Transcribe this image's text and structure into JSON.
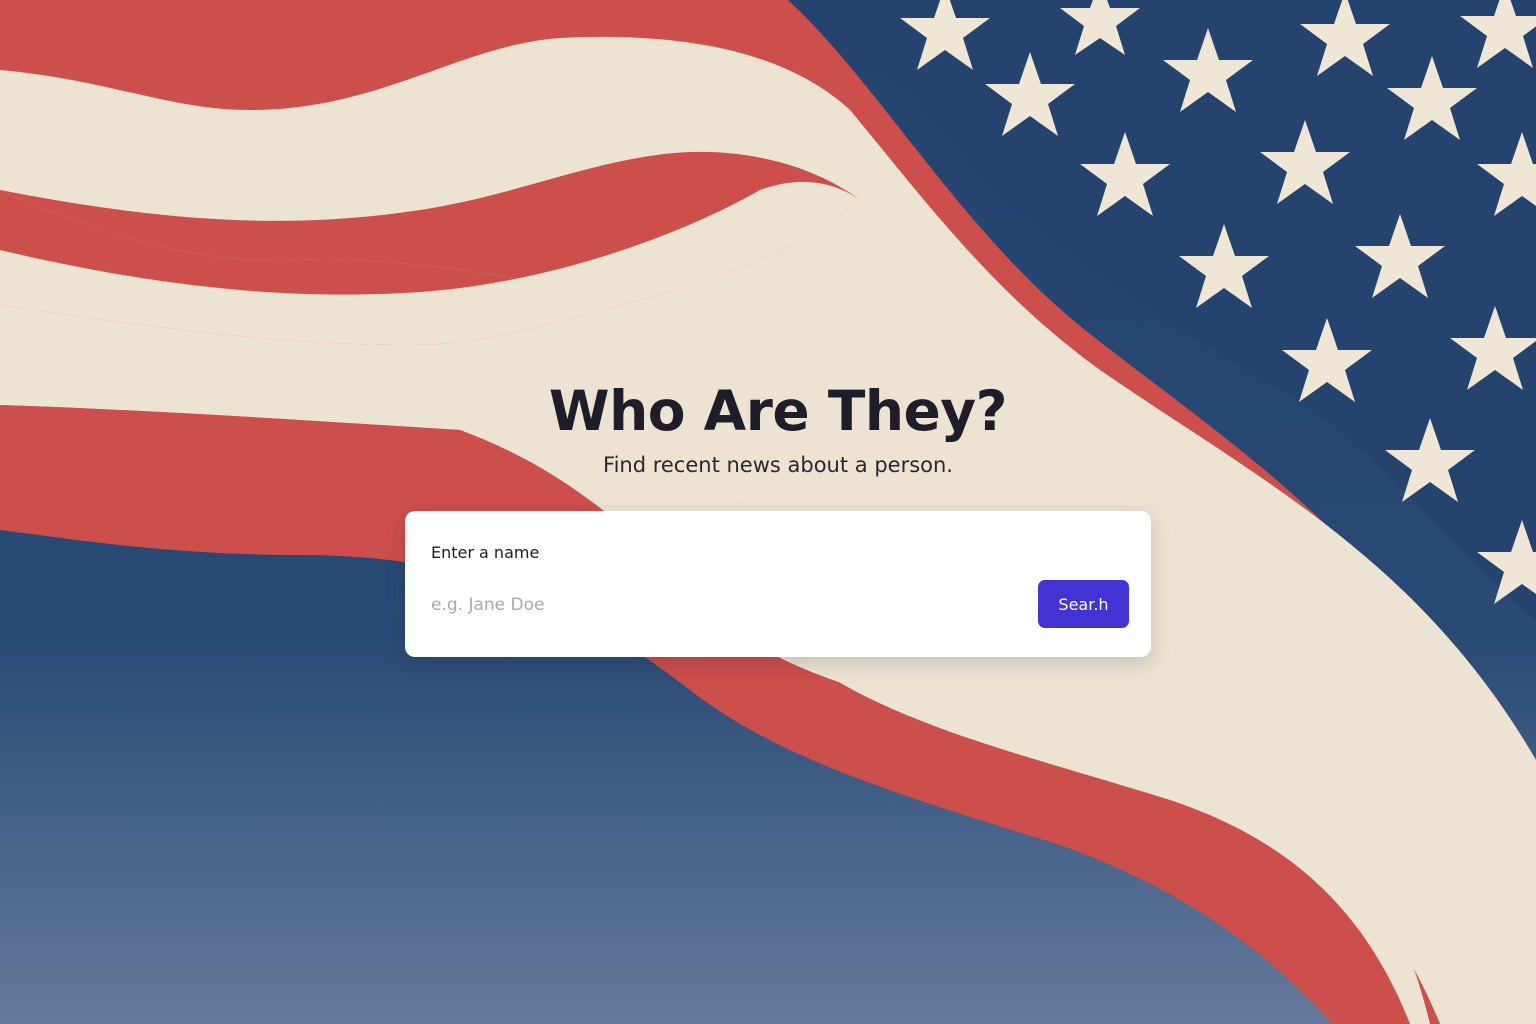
{
  "hero": {
    "title": "Who Are They?",
    "subtitle": "Find recent news about a person."
  },
  "search": {
    "label": "Enter a name",
    "placeholder": "e.g. Jane Doe",
    "value": "",
    "button_label": "Sear.h"
  },
  "background": {
    "flag": "american-flag-illustration",
    "colors": {
      "red": "#cd4f4b",
      "cream": "#ede3d3",
      "navy": "#24436e",
      "star": "#efe6d6",
      "button": "#4433d4"
    }
  }
}
